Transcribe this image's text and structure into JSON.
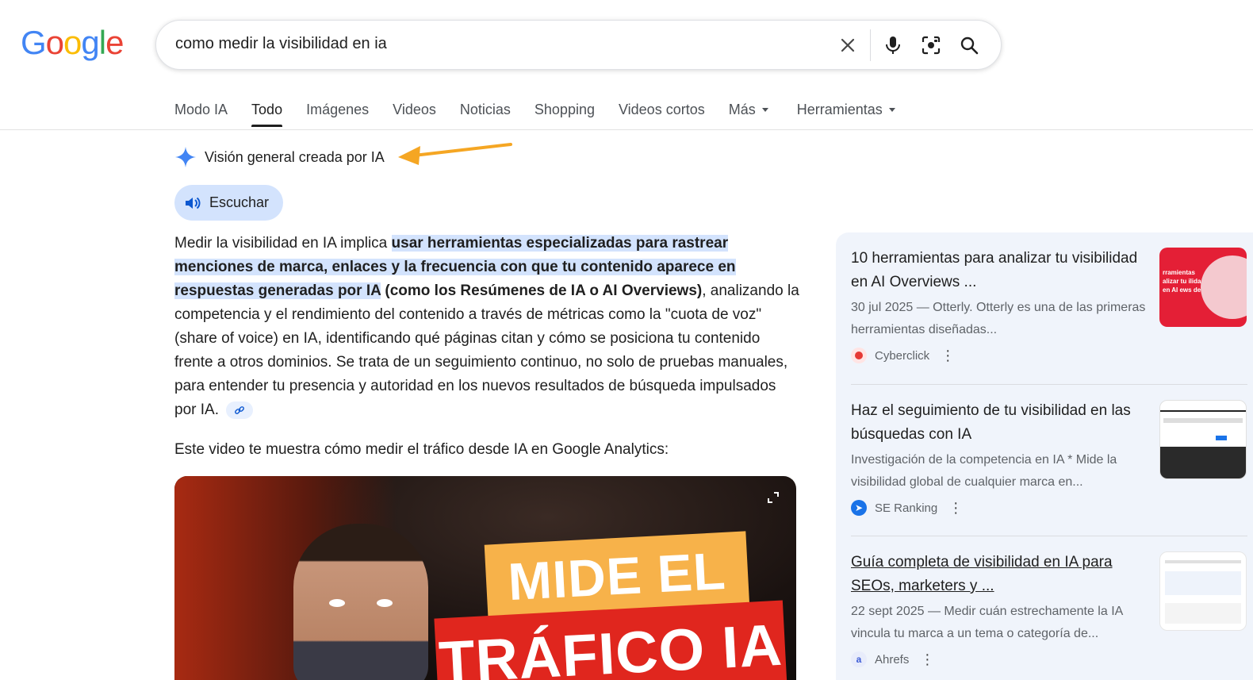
{
  "logo": {
    "text": "Google",
    "letters": [
      "G",
      "o",
      "o",
      "g",
      "l",
      "e"
    ],
    "colors": [
      "#4285F4",
      "#EA4335",
      "#FBBC05",
      "#4285F4",
      "#34A853",
      "#EA4335"
    ]
  },
  "search": {
    "query": "como medir la visibilidad en ia"
  },
  "search_icons": [
    "close-icon",
    "microphone-icon",
    "lens-icon",
    "search-icon"
  ],
  "tabs": [
    {
      "label": "Modo IA",
      "active": false
    },
    {
      "label": "Todo",
      "active": true
    },
    {
      "label": "Imágenes",
      "active": false
    },
    {
      "label": "Videos",
      "active": false
    },
    {
      "label": "Noticias",
      "active": false
    },
    {
      "label": "Shopping",
      "active": false
    },
    {
      "label": "Videos cortos",
      "active": false
    },
    {
      "label": "Más",
      "active": false,
      "dropdown": true
    },
    {
      "label": "Herramientas",
      "active": false,
      "dropdown": true
    }
  ],
  "ai_overview": {
    "header": "Visión general creada por IA",
    "listen_label": "Escuchar",
    "text_intro": "Medir la visibilidad en IA implica ",
    "text_highlight": "usar herramientas especializadas para rastrear menciones de marca, enlaces y la frecuencia con que tu contenido aparece en respuestas generadas por IA",
    "text_bold": " (como los Resúmenes de IA o AI Overviews)",
    "text_rest": ", analizando la competencia y el rendimiento del contenido a través de métricas como la \"cuota de voz\" (share of voice) en IA, identificando qué páginas citan y cómo se posiciona tu contenido frente a otros dominios. Se trata de un seguimiento continuo, no solo de pruebas manuales, para entender tu presencia y autoridad en los nuevos resultados de búsqueda impulsados por IA.",
    "video_intro": "Este video te muestra cómo medir el tráfico desde IA en Google Analytics:",
    "video_banner_top": "MIDE EL",
    "video_banner_bottom": "TRÁFICO IA"
  },
  "sources": [
    {
      "title": "10 herramientas para analizar tu visibilidad en AI Overviews ...",
      "snippet": "30 jul 2025 — Otterly. Otterly es una de las primeras herramientas diseñadas...",
      "site": "Cyberclick",
      "favicon_color": "#e53935",
      "thumb_text": "rramientas alizar tu ilidad en AI ews de"
    },
    {
      "title": "Haz el seguimiento de tu visibilidad en las búsquedas con IA",
      "snippet": "Investigación de la competencia en IA * Mide la visibilidad global de cualquier marca en...",
      "site": "SE Ranking",
      "favicon_color": "#1a73e8"
    },
    {
      "title": "Guía completa de visibilidad en IA para SEOs, marketers y ...",
      "snippet": "22 sept 2025 — Medir cuán estrechamente la IA vincula tu marca a un tema o categoría de...",
      "site": "Ahrefs",
      "favicon_color": "#3c5bd6"
    }
  ],
  "colors": {
    "accent": "#d3e3fd",
    "annotation_arrow": "#f5a623"
  }
}
